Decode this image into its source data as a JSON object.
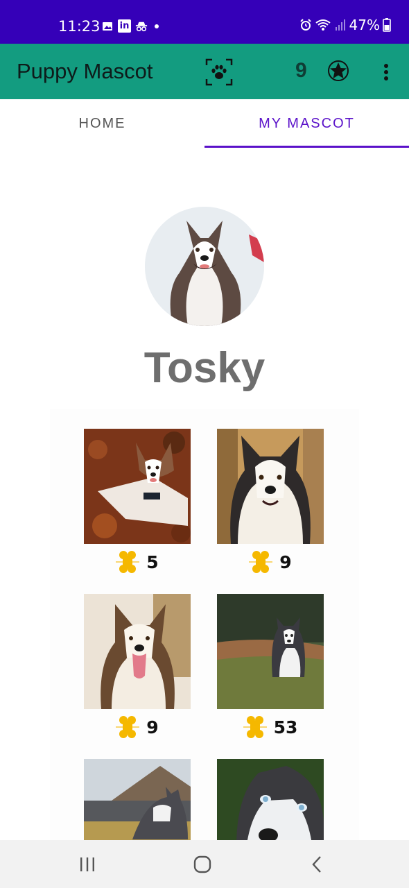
{
  "status_bar": {
    "time": "11:23",
    "battery": "47%",
    "left_icons": [
      "image-icon",
      "linkedin-icon",
      "incognito-icon",
      "dot-icon"
    ],
    "right_icons": [
      "alarm-icon",
      "wifi-icon",
      "signal-icon",
      "battery-icon"
    ]
  },
  "app_bar": {
    "title": "Puppy Mascot",
    "points": "9",
    "icons": [
      "paw-scan-icon",
      "star-badge-icon",
      "more-vert-icon"
    ]
  },
  "tabs": [
    {
      "label": "HOME",
      "active": false
    },
    {
      "label": "MY MASCOT",
      "active": true
    }
  ],
  "mascot": {
    "name": "Tosky"
  },
  "gallery": [
    {
      "likes": "5"
    },
    {
      "likes": "9"
    },
    {
      "likes": "9"
    },
    {
      "likes": "53"
    },
    {
      "likes": ""
    },
    {
      "likes": ""
    }
  ],
  "colors": {
    "status_bar": "#3500b8",
    "app_bar": "#139c80",
    "accent": "#5a11c9",
    "bone": "#f5b800"
  },
  "nav_bar": {
    "icons": [
      "recents-icon",
      "home-icon",
      "back-icon"
    ]
  }
}
